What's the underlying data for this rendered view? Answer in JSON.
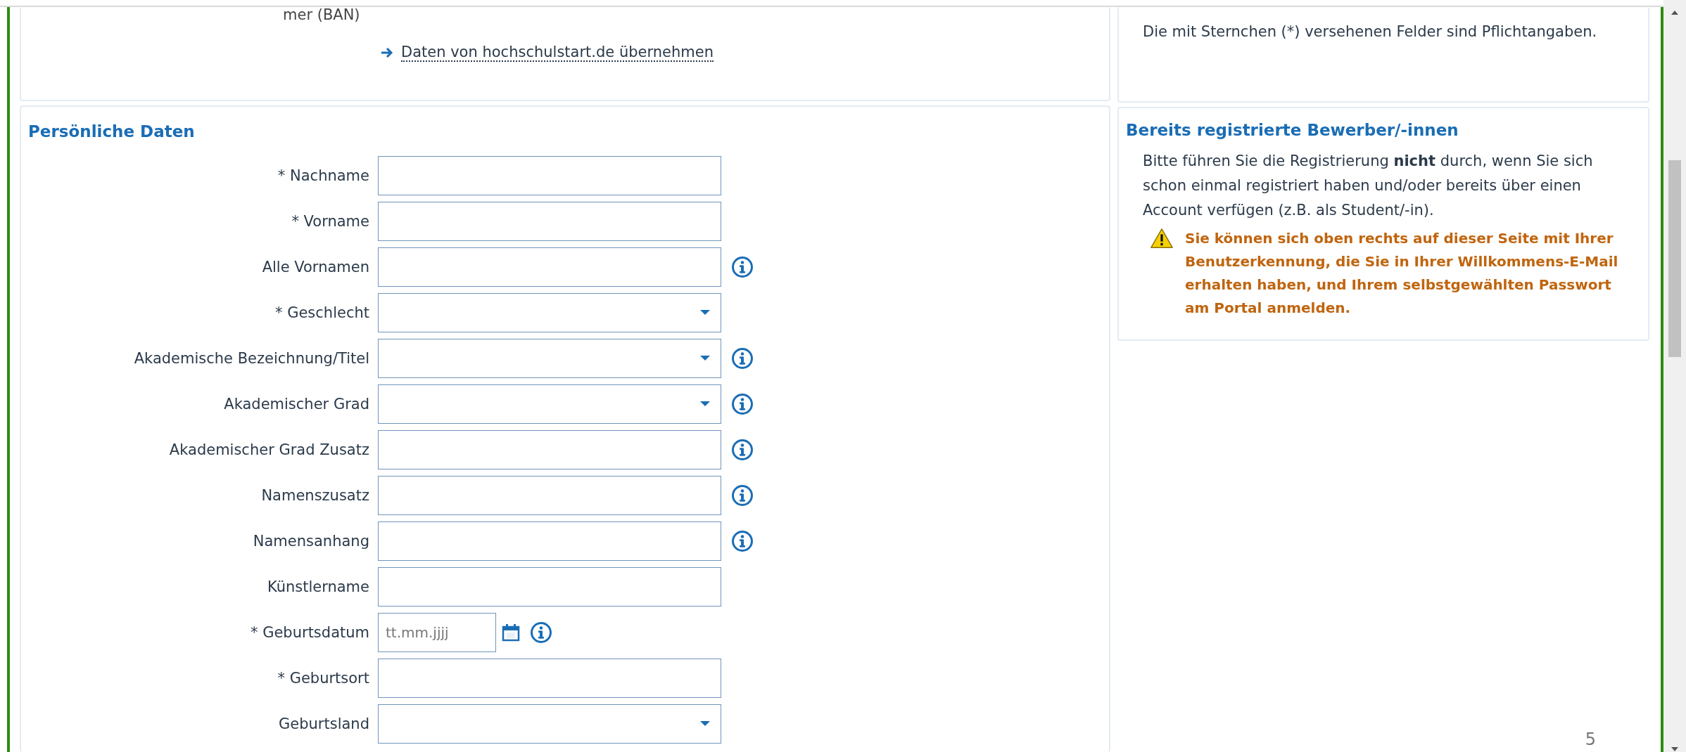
{
  "top_card": {
    "label_fragment": "mer (BAN)",
    "link": "Daten von hochschulstart.de übernehmen"
  },
  "personal_data": {
    "title": "Persönliche Daten",
    "fields": [
      {
        "label": "* Nachname",
        "kind": "text",
        "info": false
      },
      {
        "label": "* Vorname",
        "kind": "text",
        "info": false
      },
      {
        "label": "Alle Vornamen",
        "kind": "text",
        "info": true
      },
      {
        "label": "* Geschlecht",
        "kind": "select",
        "info": false
      },
      {
        "label": "Akademische Bezeichnung/Titel",
        "kind": "select",
        "info": true
      },
      {
        "label": "Akademischer Grad",
        "kind": "select",
        "info": true
      },
      {
        "label": "Akademischer Grad Zusatz",
        "kind": "text",
        "info": true
      },
      {
        "label": "Namenszusatz",
        "kind": "text",
        "info": true
      },
      {
        "label": "Namensanhang",
        "kind": "text",
        "info": true
      },
      {
        "label": "Künstlername",
        "kind": "text",
        "info": false
      },
      {
        "label": "* Geburtsdatum",
        "kind": "date",
        "placeholder": "tt.mm.jjjj",
        "info": true
      },
      {
        "label": "* Geburtsort",
        "kind": "text",
        "info": false
      },
      {
        "label": "Geburtsland",
        "kind": "select",
        "info": false
      }
    ]
  },
  "notice_card": {
    "text": "Die mit Sternchen (*) versehenen Felder sind Pflichtangaben."
  },
  "registered_card": {
    "title": "Bereits registrierte Bewerber/-innen",
    "text": "Bitte führen Sie die Registrierung **nicht** durch, wenn Sie sich schon einmal registriert haben und/oder bereits über einen Account verfügen (z.B. als Student/-in).",
    "warning": "Sie können sich oben rechts auf dieser Seite mit Ihrer Benutzerkennung, die Sie in Ihrer Willkommens-E-Mail erhalten haben, und Ihrem selbstgewählten Passwort am Portal anmelden."
  },
  "page_number": "5"
}
